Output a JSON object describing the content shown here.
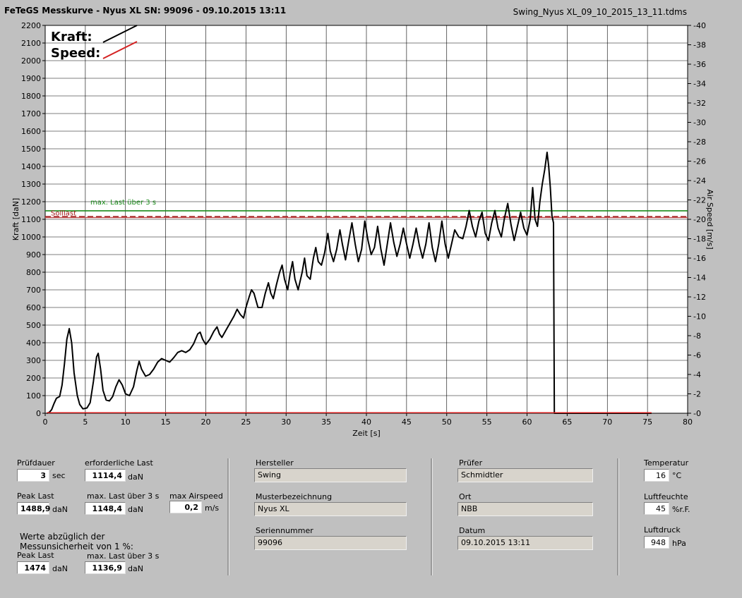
{
  "header": {
    "title": "FeTeGS Messkurve - Nyus XL  SN: 99096 - 09.10.2015 13:11",
    "file": "Swing_Nyus XL_09_10_2015_13_11.tdms"
  },
  "chart_data": {
    "type": "line",
    "xlabel": "Zeit [s]",
    "ylabel": "Kraft [daN]",
    "y2label": "Air Speed [m/s]",
    "xlim": [
      0,
      80
    ],
    "ylim": [
      0,
      2200
    ],
    "y2lim": [
      0,
      40
    ],
    "xticks": [
      "0",
      "5",
      "10",
      "15",
      "20",
      "25",
      "30",
      "35",
      "40",
      "45",
      "50",
      "55",
      "60",
      "65",
      "70",
      "75",
      "80"
    ],
    "yticks": [
      "0",
      "100",
      "200",
      "300",
      "400",
      "500",
      "600",
      "700",
      "800",
      "900",
      "1000",
      "1100",
      "1200",
      "1300",
      "1400",
      "1500",
      "1600",
      "1700",
      "1800",
      "1900",
      "2000",
      "2100",
      "2200"
    ],
    "y2ticks": [
      "0",
      "2",
      "4",
      "6",
      "8",
      "10",
      "12",
      "14",
      "16",
      "18",
      "20",
      "22",
      "24",
      "26",
      "28",
      "30",
      "32",
      "34",
      "36",
      "38",
      "40"
    ],
    "grid": true,
    "legend_position": "top-left",
    "legend": [
      {
        "name": "Kraft:",
        "color": "#000000"
      },
      {
        "name": "Speed:",
        "color": "#d42020"
      }
    ],
    "reference_lines": [
      {
        "name": "max. Last über  3 s",
        "value": 1148.4,
        "color": "#1a8a1a",
        "style": "solid"
      },
      {
        "name": "Solllast",
        "value": 1114.4,
        "color": "#a01818",
        "style": "dashed"
      },
      {
        "name": "",
        "value": 1110,
        "color": "#c05050",
        "style": "solid"
      }
    ],
    "series": [
      {
        "name": "Kraft:",
        "color": "#000000",
        "points": [
          [
            0.2,
            0
          ],
          [
            0.5,
            5
          ],
          [
            0.8,
            20
          ],
          [
            1.1,
            55
          ],
          [
            1.4,
            85
          ],
          [
            1.8,
            95
          ],
          [
            2.1,
            160
          ],
          [
            2.4,
            280
          ],
          [
            2.7,
            420
          ],
          [
            3.0,
            480
          ],
          [
            3.3,
            400
          ],
          [
            3.6,
            230
          ],
          [
            4.0,
            100
          ],
          [
            4.3,
            50
          ],
          [
            4.7,
            25
          ],
          [
            5.2,
            30
          ],
          [
            5.6,
            60
          ],
          [
            6.0,
            180
          ],
          [
            6.4,
            320
          ],
          [
            6.6,
            340
          ],
          [
            6.9,
            250
          ],
          [
            7.2,
            130
          ],
          [
            7.6,
            75
          ],
          [
            8.0,
            70
          ],
          [
            8.4,
            95
          ],
          [
            8.8,
            150
          ],
          [
            9.2,
            190
          ],
          [
            9.6,
            160
          ],
          [
            10.0,
            110
          ],
          [
            10.5,
            100
          ],
          [
            11.0,
            150
          ],
          [
            11.4,
            240
          ],
          [
            11.7,
            295
          ],
          [
            12.0,
            250
          ],
          [
            12.5,
            210
          ],
          [
            13.0,
            220
          ],
          [
            13.5,
            250
          ],
          [
            14.0,
            290
          ],
          [
            14.5,
            310
          ],
          [
            15.0,
            300
          ],
          [
            15.5,
            290
          ],
          [
            16.0,
            315
          ],
          [
            16.5,
            345
          ],
          [
            17.0,
            355
          ],
          [
            17.5,
            345
          ],
          [
            18.0,
            360
          ],
          [
            18.5,
            395
          ],
          [
            19.0,
            450
          ],
          [
            19.3,
            460
          ],
          [
            19.6,
            420
          ],
          [
            20.0,
            390
          ],
          [
            20.5,
            420
          ],
          [
            21.0,
            465
          ],
          [
            21.4,
            490
          ],
          [
            21.7,
            450
          ],
          [
            22.0,
            430
          ],
          [
            22.5,
            470
          ],
          [
            23.0,
            510
          ],
          [
            23.5,
            550
          ],
          [
            23.9,
            590
          ],
          [
            24.3,
            560
          ],
          [
            24.7,
            540
          ],
          [
            25.0,
            600
          ],
          [
            25.4,
            660
          ],
          [
            25.7,
            700
          ],
          [
            26.0,
            680
          ],
          [
            26.5,
            600
          ],
          [
            27.0,
            600
          ],
          [
            27.4,
            680
          ],
          [
            27.8,
            740
          ],
          [
            28.1,
            680
          ],
          [
            28.4,
            650
          ],
          [
            28.8,
            730
          ],
          [
            29.2,
            800
          ],
          [
            29.5,
            840
          ],
          [
            29.8,
            760
          ],
          [
            30.2,
            700
          ],
          [
            30.5,
            790
          ],
          [
            30.8,
            860
          ],
          [
            31.1,
            760
          ],
          [
            31.5,
            700
          ],
          [
            32.0,
            800
          ],
          [
            32.3,
            880
          ],
          [
            32.6,
            780
          ],
          [
            33.0,
            760
          ],
          [
            33.4,
            880
          ],
          [
            33.7,
            940
          ],
          [
            34.0,
            860
          ],
          [
            34.4,
            840
          ],
          [
            34.8,
            910
          ],
          [
            35.2,
            1020
          ],
          [
            35.5,
            920
          ],
          [
            35.9,
            860
          ],
          [
            36.3,
            930
          ],
          [
            36.7,
            1040
          ],
          [
            37.0,
            960
          ],
          [
            37.4,
            870
          ],
          [
            37.8,
            980
          ],
          [
            38.2,
            1080
          ],
          [
            38.6,
            960
          ],
          [
            39.0,
            860
          ],
          [
            39.4,
            930
          ],
          [
            39.8,
            1090
          ],
          [
            40.2,
            980
          ],
          [
            40.6,
            900
          ],
          [
            41.0,
            940
          ],
          [
            41.4,
            1060
          ],
          [
            41.8,
            930
          ],
          [
            42.2,
            840
          ],
          [
            42.6,
            960
          ],
          [
            43.0,
            1080
          ],
          [
            43.4,
            970
          ],
          [
            43.8,
            890
          ],
          [
            44.2,
            960
          ],
          [
            44.6,
            1050
          ],
          [
            45.0,
            960
          ],
          [
            45.4,
            880
          ],
          [
            45.8,
            960
          ],
          [
            46.2,
            1050
          ],
          [
            46.6,
            950
          ],
          [
            47.0,
            880
          ],
          [
            47.4,
            960
          ],
          [
            47.8,
            1080
          ],
          [
            48.2,
            940
          ],
          [
            48.6,
            860
          ],
          [
            49.0,
            960
          ],
          [
            49.4,
            1090
          ],
          [
            49.8,
            960
          ],
          [
            50.2,
            880
          ],
          [
            50.6,
            960
          ],
          [
            51.0,
            1040
          ],
          [
            51.5,
            1000
          ],
          [
            52.0,
            990
          ],
          [
            52.4,
            1060
          ],
          [
            52.8,
            1150
          ],
          [
            53.2,
            1060
          ],
          [
            53.6,
            1000
          ],
          [
            54.0,
            1090
          ],
          [
            54.4,
            1140
          ],
          [
            54.8,
            1020
          ],
          [
            55.2,
            980
          ],
          [
            55.6,
            1080
          ],
          [
            56.0,
            1150
          ],
          [
            56.4,
            1050
          ],
          [
            56.8,
            1000
          ],
          [
            57.2,
            1110
          ],
          [
            57.6,
            1190
          ],
          [
            58.0,
            1070
          ],
          [
            58.4,
            980
          ],
          [
            58.8,
            1060
          ],
          [
            59.2,
            1140
          ],
          [
            59.6,
            1050
          ],
          [
            60.0,
            1010
          ],
          [
            60.4,
            1100
          ],
          [
            60.7,
            1280
          ],
          [
            61.0,
            1100
          ],
          [
            61.3,
            1060
          ],
          [
            61.6,
            1200
          ],
          [
            61.9,
            1300
          ],
          [
            62.2,
            1380
          ],
          [
            62.5,
            1480
          ],
          [
            62.7,
            1400
          ],
          [
            62.9,
            1280
          ],
          [
            63.1,
            1120
          ],
          [
            63.3,
            1080
          ],
          [
            63.4,
            0
          ],
          [
            65.0,
            0
          ],
          [
            70.0,
            0
          ],
          [
            75.5,
            0
          ]
        ]
      },
      {
        "name": "Speed:",
        "color": "#d42020",
        "points": [
          [
            0.2,
            0.05
          ],
          [
            10,
            0.05
          ],
          [
            20,
            0.05
          ],
          [
            30,
            0.05
          ],
          [
            40,
            0.05
          ],
          [
            50,
            0.05
          ],
          [
            60,
            0.05
          ],
          [
            63.3,
            0.05
          ],
          [
            75.5,
            0.05
          ]
        ]
      }
    ]
  },
  "stats": {
    "pruefdauer_label": "Prüfdauer",
    "pruefdauer_value": "3",
    "pruefdauer_unit": "sec",
    "erforderliche_label": "erforderliche Last",
    "erforderliche_value": "1114,4",
    "erforderliche_unit": "daN",
    "peak_label": "Peak Last",
    "peak_value": "1488,9",
    "peak_unit": "daN",
    "maxlast_label": "max. Last über  3 s",
    "maxlast_value": "1148,4",
    "maxlast_unit": "daN",
    "airspeed_label": "max Airspeed",
    "airspeed_value": "0,2",
    "airspeed_unit": "m/s",
    "werte_label_1": "Werte abzüglich der",
    "werte_label_2": "Messunsicherheit von 1  %:",
    "peak2_label": "Peak Last",
    "peak2_value": "1474",
    "peak2_unit": "daN",
    "maxlast2_label": "max. Last über  3 s",
    "maxlast2_value": "1136,9",
    "maxlast2_unit": "daN"
  },
  "info": {
    "hersteller_label": "Hersteller",
    "hersteller_value": "Swing",
    "muster_label": "Musterbezeichnung",
    "muster_value": "Nyus XL",
    "serie_label": "Seriennummer",
    "serie_value": "99096",
    "pruefer_label": "Prüfer",
    "pruefer_value": "Schmidtler",
    "ort_label": "Ort",
    "ort_value": "NBB",
    "datum_label": "Datum",
    "datum_value": "09.10.2015 13:11"
  },
  "env": {
    "temp_label": "Temperatur",
    "temp_value": "16",
    "temp_unit": "°C",
    "feuchte_label": "Luftfeuchte",
    "feuchte_value": "45",
    "feuchte_unit": "%r.F.",
    "druck_label": "Luftdruck",
    "druck_value": "948",
    "druck_unit": "hPa"
  }
}
